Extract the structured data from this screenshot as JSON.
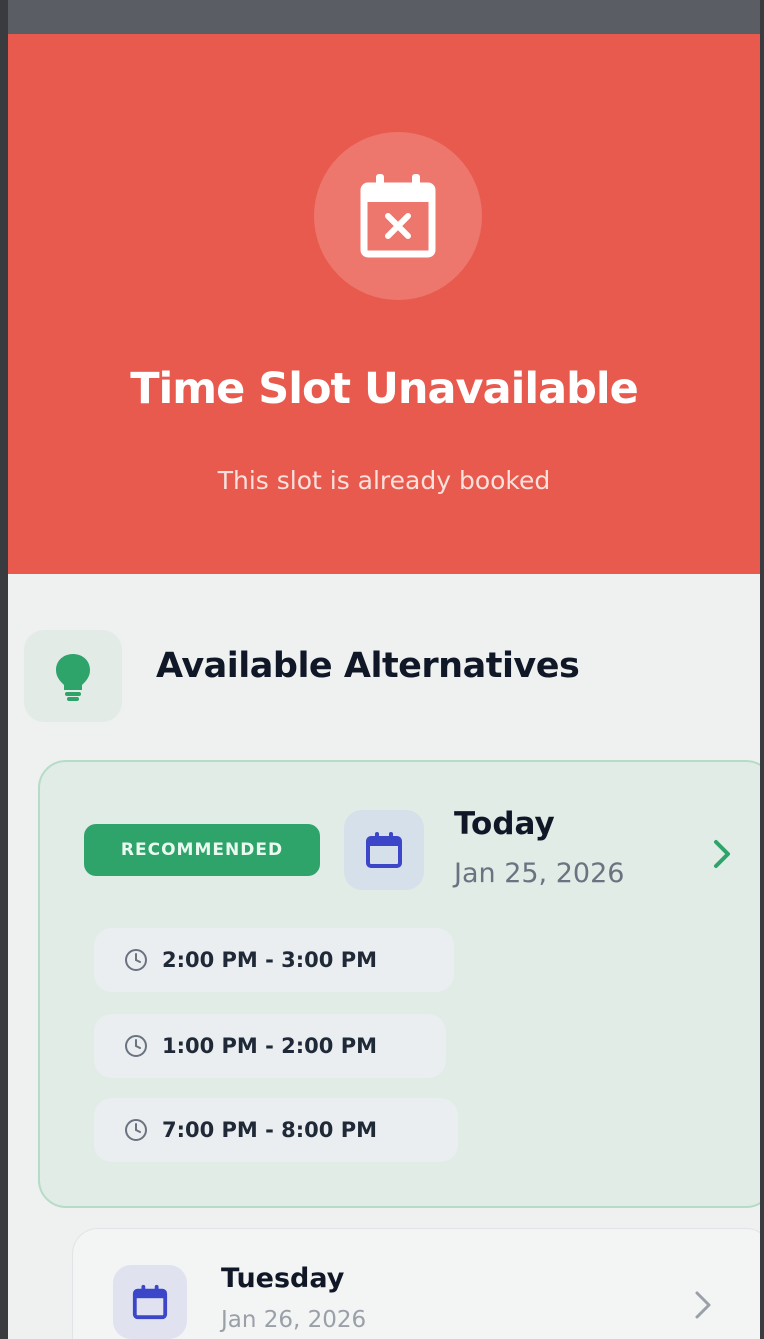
{
  "hero": {
    "title": "Time Slot Unavailable",
    "subtitle": "This slot is already booked",
    "icon": "calendar-x-icon",
    "color": "#e95a4e"
  },
  "section": {
    "title": "Available Alternatives",
    "icon": "lightbulb-icon"
  },
  "recommended_day": {
    "badge": "RECOMMENDED",
    "day": "Today",
    "date": "Jan 25, 2026",
    "slots": [
      "2:00 PM - 3:00 PM",
      "1:00 PM - 2:00 PM",
      "7:00 PM - 8:00 PM"
    ]
  },
  "other_day": {
    "day": "Tuesday",
    "date": "Jan 26, 2026"
  },
  "colors": {
    "accent_green": "#2ea36a",
    "calendar_blue": "#3b46c8"
  }
}
